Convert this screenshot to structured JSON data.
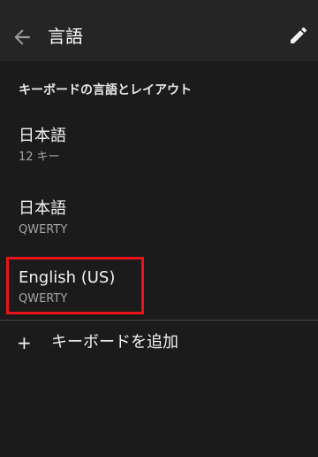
{
  "appbar": {
    "title": "言語",
    "back_icon": "arrow-left-icon",
    "edit_icon": "pencil-icon"
  },
  "section": {
    "header": "キーボードの言語とレイアウト"
  },
  "languages": [
    {
      "name": "日本語",
      "layout": "12 キー"
    },
    {
      "name": "日本語",
      "layout": "QWERTY"
    },
    {
      "name": "English (US)",
      "layout": "QWERTY",
      "highlighted": true
    }
  ],
  "add_keyboard": {
    "icon": "+",
    "label": "キーボードを追加"
  },
  "colors": {
    "background": "#1b1b1b",
    "appbar": "#252525",
    "text_primary": "#f2f2f2",
    "text_secondary": "#a5a5a5",
    "highlight": "#e8141b"
  }
}
